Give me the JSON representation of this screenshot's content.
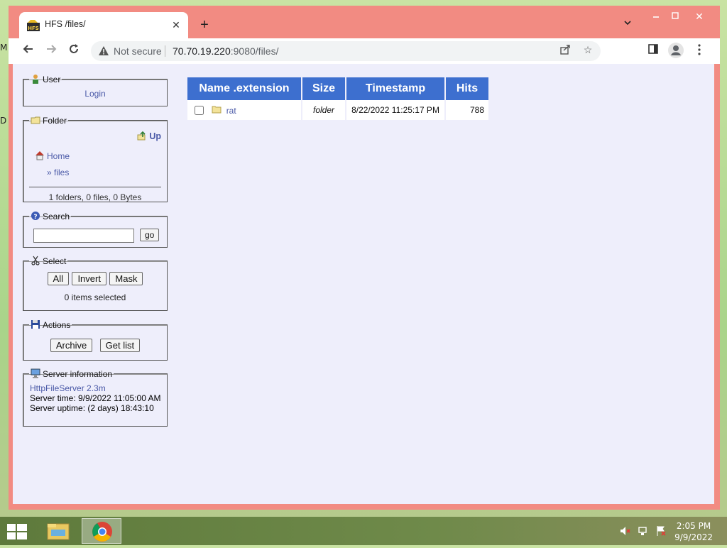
{
  "desktop": {
    "edge_letters": [
      "M",
      "D"
    ]
  },
  "browser": {
    "tab_title": "HFS /files/",
    "security_label": "Not secure",
    "url_host": "70.70.19.220",
    "url_rest": ":9080/files/"
  },
  "sidebar": {
    "user": {
      "legend": "User",
      "login": "Login"
    },
    "folder": {
      "legend": "Folder",
      "up": "Up",
      "home": "Home",
      "current": "» files",
      "summary": "1 folders, 0 files, 0 Bytes"
    },
    "search": {
      "legend": "Search",
      "placeholder": "",
      "go": "go"
    },
    "select": {
      "legend": "Select",
      "all": "All",
      "invert": "Invert",
      "mask": "Mask",
      "status": "0 items selected"
    },
    "actions": {
      "legend": "Actions",
      "archive": "Archive",
      "get_list": "Get list"
    },
    "server": {
      "legend": "Server information",
      "version": "HttpFileServer 2.3m",
      "time": "Server time: 9/9/2022 11:05:00 AM",
      "uptime": "Server uptime: (2 days) 18:43:10"
    }
  },
  "files_table": {
    "headers": [
      "Name .extension",
      "Size",
      "Timestamp",
      "Hits"
    ],
    "rows": [
      {
        "name": "rat",
        "size": "folder",
        "timestamp": "8/22/2022 11:25:17 PM",
        "hits": "788"
      }
    ]
  },
  "taskbar": {
    "time": "2:05 PM",
    "date": "9/9/2022"
  },
  "colors": {
    "header_blue": "#3d6fcf",
    "page_bg": "#eeeefb",
    "window_frame": "#f28b82",
    "link": "#4b5aa8"
  }
}
